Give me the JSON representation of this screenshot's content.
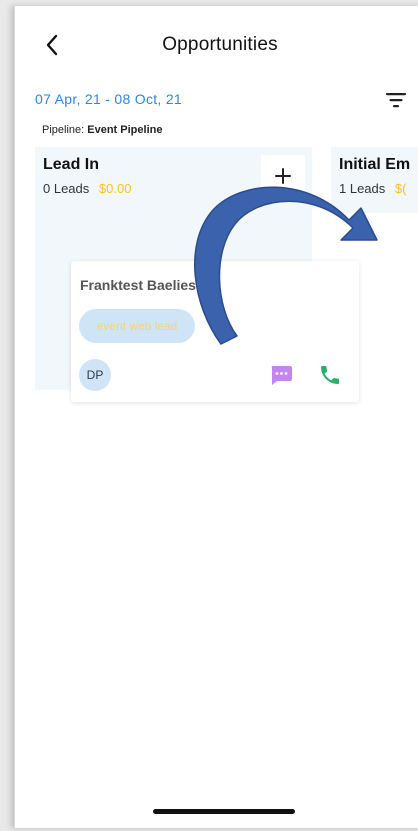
{
  "header": {
    "title": "Opportunities",
    "back_icon": "chevron-left-icon",
    "filter_icon": "filter-icon"
  },
  "date_range": "07 Apr, 21 - 08 Oct, 21",
  "pipeline": {
    "label": "Pipeline:",
    "name": "Event Pipeline"
  },
  "columns": [
    {
      "title": "Lead In",
      "leads": "0 Leads",
      "amount": "$0.00"
    },
    {
      "title": "Initial Em",
      "leads": "1 Leads",
      "amount": "$("
    }
  ],
  "card": {
    "name": "Franktest Baeliest",
    "tag": "event web lead",
    "avatar_initials": "DP",
    "message_icon": "chat-bubble-icon",
    "call_icon": "phone-icon"
  },
  "colors": {
    "accent_blue": "#2e86de",
    "amount_yellow": "#f5c518",
    "arrow_blue": "#3b63ad",
    "message_purple": "#c485f0",
    "call_green": "#27b06b"
  }
}
